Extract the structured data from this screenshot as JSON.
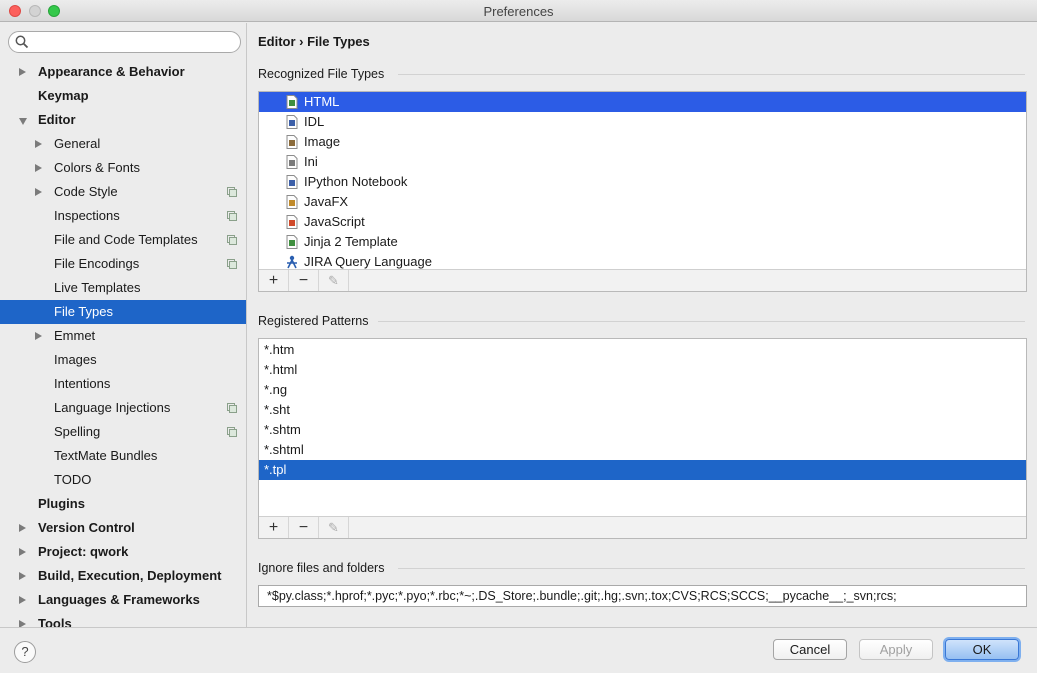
{
  "window": {
    "title": "Preferences"
  },
  "search": {
    "placeholder": ""
  },
  "sidebar": {
    "items": [
      {
        "label": "Appearance & Behavior",
        "level": 0,
        "arrow": "right",
        "project": false,
        "selected": false
      },
      {
        "label": "Keymap",
        "level": 0,
        "arrow": "none",
        "project": false,
        "selected": false
      },
      {
        "label": "Editor",
        "level": 0,
        "arrow": "down",
        "project": false,
        "selected": false
      },
      {
        "label": "General",
        "level": 1,
        "arrow": "right",
        "project": false,
        "selected": false
      },
      {
        "label": "Colors & Fonts",
        "level": 1,
        "arrow": "right",
        "project": false,
        "selected": false
      },
      {
        "label": "Code Style",
        "level": 1,
        "arrow": "right",
        "project": true,
        "selected": false
      },
      {
        "label": "Inspections",
        "level": 1,
        "arrow": "none",
        "project": true,
        "selected": false
      },
      {
        "label": "File and Code Templates",
        "level": 1,
        "arrow": "none",
        "project": true,
        "selected": false
      },
      {
        "label": "File Encodings",
        "level": 1,
        "arrow": "none",
        "project": true,
        "selected": false
      },
      {
        "label": "Live Templates",
        "level": 1,
        "arrow": "none",
        "project": false,
        "selected": false
      },
      {
        "label": "File Types",
        "level": 1,
        "arrow": "none",
        "project": false,
        "selected": true
      },
      {
        "label": "Emmet",
        "level": 1,
        "arrow": "right",
        "project": false,
        "selected": false
      },
      {
        "label": "Images",
        "level": 1,
        "arrow": "none",
        "project": false,
        "selected": false
      },
      {
        "label": "Intentions",
        "level": 1,
        "arrow": "none",
        "project": false,
        "selected": false
      },
      {
        "label": "Language Injections",
        "level": 1,
        "arrow": "none",
        "project": true,
        "selected": false
      },
      {
        "label": "Spelling",
        "level": 1,
        "arrow": "none",
        "project": true,
        "selected": false
      },
      {
        "label": "TextMate Bundles",
        "level": 1,
        "arrow": "none",
        "project": false,
        "selected": false
      },
      {
        "label": "TODO",
        "level": 1,
        "arrow": "none",
        "project": false,
        "selected": false
      },
      {
        "label": "Plugins",
        "level": 0,
        "arrow": "none",
        "project": false,
        "selected": false
      },
      {
        "label": "Version Control",
        "level": 0,
        "arrow": "right",
        "project": false,
        "selected": false
      },
      {
        "label": "Project: qwork",
        "level": 0,
        "arrow": "right",
        "project": false,
        "selected": false
      },
      {
        "label": "Build, Execution, Deployment",
        "level": 0,
        "arrow": "right",
        "project": false,
        "selected": false
      },
      {
        "label": "Languages & Frameworks",
        "level": 0,
        "arrow": "right",
        "project": false,
        "selected": false
      },
      {
        "label": "Tools",
        "level": 0,
        "arrow": "right",
        "project": false,
        "selected": false
      }
    ]
  },
  "main": {
    "breadcrumb": "Editor › File Types",
    "recognized": {
      "title": "Recognized File Types",
      "items": [
        {
          "label": "HTML",
          "icon": "html-file-icon",
          "color": "#3f8f3f",
          "selected": true
        },
        {
          "label": "IDL",
          "icon": "idl-file-icon",
          "color": "#3c5fa8",
          "selected": false
        },
        {
          "label": "Image",
          "icon": "image-file-icon",
          "color": "#8a6a3a",
          "selected": false
        },
        {
          "label": "Ini",
          "icon": "ini-file-icon",
          "color": "#7a7a7a",
          "selected": false
        },
        {
          "label": "IPython Notebook",
          "icon": "ipython-file-icon",
          "color": "#3c5fa8",
          "selected": false
        },
        {
          "label": "JavaFX",
          "icon": "javafx-file-icon",
          "color": "#c08a2a",
          "selected": false
        },
        {
          "label": "JavaScript",
          "icon": "javascript-file-icon",
          "color": "#d04a2a",
          "selected": false
        },
        {
          "label": "Jinja 2 Template",
          "icon": "jinja-file-icon",
          "color": "#3f8f3f",
          "selected": false
        },
        {
          "label": "JIRA Query Language",
          "icon": "jira-icon",
          "color": "#2a5fb0",
          "selected": false
        }
      ]
    },
    "patterns": {
      "title": "Registered Patterns",
      "items": [
        {
          "label": "*.htm",
          "selected": false
        },
        {
          "label": "*.html",
          "selected": false
        },
        {
          "label": "*.ng",
          "selected": false
        },
        {
          "label": "*.sht",
          "selected": false
        },
        {
          "label": "*.shtm",
          "selected": false
        },
        {
          "label": "*.shtml",
          "selected": false
        },
        {
          "label": "*.tpl",
          "selected": true
        }
      ]
    },
    "toolbar": {
      "add": "+",
      "remove": "−",
      "edit": "✎"
    },
    "ignore": {
      "title": "Ignore files and folders",
      "value": "*$py.class;*.hprof;*.pyc;*.pyo;*.rbc;*~;.DS_Store;.bundle;.git;.hg;.svn;.tox;CVS;RCS;SCCS;__pycache__;_svn;rcs;"
    }
  },
  "footer": {
    "help": "?",
    "cancel": "Cancel",
    "apply": "Apply",
    "ok": "OK"
  },
  "colors": {
    "selection_sidebar": "#1e65c8",
    "selection_list": "#2c5ce6"
  }
}
